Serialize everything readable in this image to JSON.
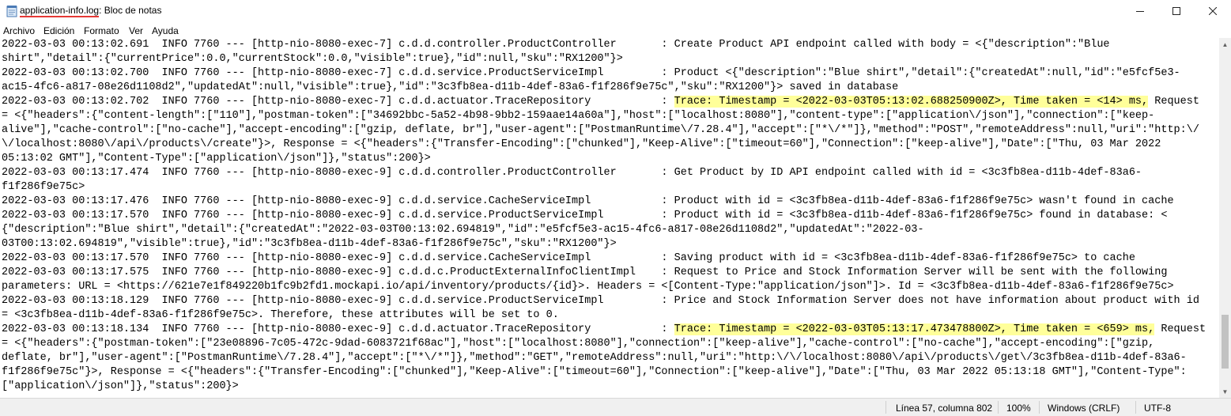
{
  "window": {
    "file_name": "application-info.log",
    "title_rest": ": Bloc de notas",
    "app_icon": "notepad-icon"
  },
  "menu": [
    "Archivo",
    "Edición",
    "Formato",
    "Ver",
    "Ayuda"
  ],
  "editor": {
    "lines": [
      {
        "text": "2022-03-03 00:13:02.691  INFO 7760 --- [http-nio-8080-exec-7] c.d.d.controller.ProductController       : Create Product API endpoint called with body = <{\"description\":\"Blue"
      },
      {
        "text": "shirt\",\"detail\":{\"currentPrice\":0.0,\"currentStock\":0.0,\"visible\":true},\"id\":null,\"sku\":\"RX1200\"}>"
      },
      {
        "text": "2022-03-03 00:13:02.700  INFO 7760 --- [http-nio-8080-exec-7] c.d.d.service.ProductServiceImpl         : Product <{\"description\":\"Blue shirt\",\"detail\":{\"createdAt\":null,\"id\":\"e5fcf5e3-"
      },
      {
        "text": "ac15-4fc6-a817-08e26d1108d2\",\"updatedAt\":null,\"visible\":true},\"id\":\"3c3fb8ea-d11b-4def-83a6-f1f286f9e75c\",\"sku\":\"RX1200\"}> saved in database"
      },
      {
        "pre": "2022-03-03 00:13:02.702  INFO 7760 --- [http-nio-8080-exec-7] c.d.d.actuator.TraceRepository           : ",
        "hl": "Trace: Timestamp = <2022-03-03T05:13:02.688250900Z>, Time taken = <14> ms,",
        "post": " Request"
      },
      {
        "text": "= <{\"headers\":{\"content-length\":[\"110\"],\"postman-token\":[\"34692bbc-5a52-4b98-9bb2-159aae14a60a\"],\"host\":[\"localhost:8080\"],\"content-type\":[\"application\\/json\"],\"connection\":[\"keep-"
      },
      {
        "text": "alive\"],\"cache-control\":[\"no-cache\"],\"accept-encoding\":[\"gzip, deflate, br\"],\"user-agent\":[\"PostmanRuntime\\/7.28.4\"],\"accept\":[\"*\\/*\"]},\"method\":\"POST\",\"remoteAddress\":null,\"uri\":\"http:\\/"
      },
      {
        "text": "\\/localhost:8080\\/api\\/products\\/create\"}>, Response = <{\"headers\":{\"Transfer-Encoding\":[\"chunked\"],\"Keep-Alive\":[\"timeout=60\"],\"Connection\":[\"keep-alive\"],\"Date\":[\"Thu, 03 Mar 2022"
      },
      {
        "text": "05:13:02 GMT\"],\"Content-Type\":[\"application\\/json\"]},\"status\":200}>"
      },
      {
        "text": "2022-03-03 00:13:17.474  INFO 7760 --- [http-nio-8080-exec-9] c.d.d.controller.ProductController       : Get Product by ID API endpoint called with id = <3c3fb8ea-d11b-4def-83a6-"
      },
      {
        "text": "f1f286f9e75c>"
      },
      {
        "text": "2022-03-03 00:13:17.476  INFO 7760 --- [http-nio-8080-exec-9] c.d.d.service.CacheServiceImpl           : Product with id = <3c3fb8ea-d11b-4def-83a6-f1f286f9e75c> wasn't found in cache"
      },
      {
        "text": "2022-03-03 00:13:17.570  INFO 7760 --- [http-nio-8080-exec-9] c.d.d.service.ProductServiceImpl         : Product with id = <3c3fb8ea-d11b-4def-83a6-f1f286f9e75c> found in database: <"
      },
      {
        "text": "{\"description\":\"Blue shirt\",\"detail\":{\"createdAt\":\"2022-03-03T00:13:02.694819\",\"id\":\"e5fcf5e3-ac15-4fc6-a817-08e26d1108d2\",\"updatedAt\":\"2022-03-"
      },
      {
        "text": "03T00:13:02.694819\",\"visible\":true},\"id\":\"3c3fb8ea-d11b-4def-83a6-f1f286f9e75c\",\"sku\":\"RX1200\"}>"
      },
      {
        "text": "2022-03-03 00:13:17.570  INFO 7760 --- [http-nio-8080-exec-9] c.d.d.service.CacheServiceImpl           : Saving product with id = <3c3fb8ea-d11b-4def-83a6-f1f286f9e75c> to cache"
      },
      {
        "text": "2022-03-03 00:13:17.575  INFO 7760 --- [http-nio-8080-exec-9] c.d.d.c.ProductExternalInfoClientImpl    : Request to Price and Stock Information Server will be sent with the following"
      },
      {
        "text": "parameters: URL = <https://621e7e1f849220b1fc9b2fd1.mockapi.io/api/inventory/products/{id}>. Headers = <[Content-Type:\"application/json\"]>. Id = <3c3fb8ea-d11b-4def-83a6-f1f286f9e75c>"
      },
      {
        "text": "2022-03-03 00:13:18.129  INFO 7760 --- [http-nio-8080-exec-9] c.d.d.service.ProductServiceImpl         : Price and Stock Information Server does not have information about product with id"
      },
      {
        "text": "= <3c3fb8ea-d11b-4def-83a6-f1f286f9e75c>. Therefore, these attributes will be set to 0."
      },
      {
        "pre": "2022-03-03 00:13:18.134  INFO 7760 --- [http-nio-8080-exec-9] c.d.d.actuator.TraceRepository           : ",
        "hl": "Trace: Timestamp = <2022-03-03T05:13:17.473478800Z>, Time taken = <659> ms,",
        "post": " Request"
      },
      {
        "text": "= <{\"headers\":{\"postman-token\":[\"23e08896-7c05-472c-9dad-6083721f68ac\"],\"host\":[\"localhost:8080\"],\"connection\":[\"keep-alive\"],\"cache-control\":[\"no-cache\"],\"accept-encoding\":[\"gzip,"
      },
      {
        "text": "deflate, br\"],\"user-agent\":[\"PostmanRuntime\\/7.28.4\"],\"accept\":[\"*\\/*\"]},\"method\":\"GET\",\"remoteAddress\":null,\"uri\":\"http:\\/\\/localhost:8080\\/api\\/products\\/get\\/3c3fb8ea-d11b-4def-83a6-"
      },
      {
        "text": "f1f286f9e75c\"}>, Response = <{\"headers\":{\"Transfer-Encoding\":[\"chunked\"],\"Keep-Alive\":[\"timeout=60\"],\"Connection\":[\"keep-alive\"],\"Date\":[\"Thu, 03 Mar 2022 05:13:18 GMT\"],\"Content-Type\":"
      },
      {
        "text": "[\"application\\/json\"]},\"status\":200}>"
      }
    ]
  },
  "status": {
    "position": "Línea 57, columna 802",
    "zoom": "100%",
    "line_endings": "Windows (CRLF)",
    "encoding": "UTF-8"
  },
  "colors": {
    "highlight": "#ffff9a",
    "underline": "#e53935"
  }
}
